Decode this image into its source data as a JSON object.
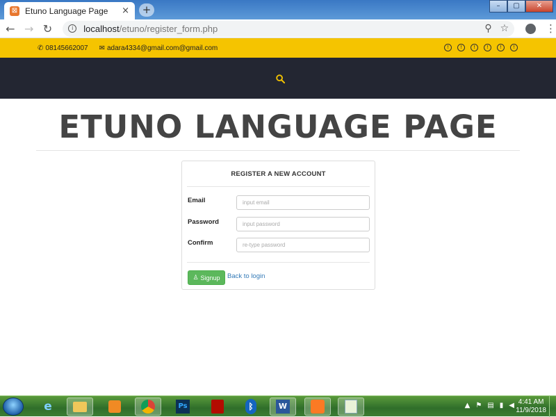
{
  "browser": {
    "tab_title": "Etuno Language Page",
    "tab_close": "×",
    "new_tab": "+",
    "window_buttons": [
      "–",
      "▢",
      "✕"
    ],
    "url_host": "localhost",
    "url_path": "/etuno/register_form.php"
  },
  "topbar": {
    "phone": "08145662007",
    "email": "adara4334@gmail.com@gmail.com",
    "social_icon_count": 6,
    "bg_color": "#f5c400"
  },
  "nav": {
    "bg_color": "#232632",
    "search_icon": "search-icon",
    "search_color": "#f5c400"
  },
  "hero": {
    "title": "ETUNO LANGUAGE PAGE"
  },
  "register": {
    "heading": "REGISTER A NEW ACCOUNT",
    "email_label": "Email",
    "email_placeholder": "input email",
    "password_label": "Password",
    "password_placeholder": "input password",
    "confirm_label": "Confirm",
    "confirm_placeholder": "re-type password",
    "signup_label": "Signup",
    "back_link": "Back to login",
    "signup_color": "#5cb85c",
    "link_color": "#337ab7"
  },
  "taskbar": {
    "apps": [
      "ie-icon",
      "explorer-icon",
      "media-player-icon",
      "chrome-icon",
      "photoshop-icon",
      "acrobat-icon",
      "bluetooth-icon",
      "word-icon",
      "xampp-icon",
      "notepad-icon"
    ],
    "ps_label": "Ps",
    "word_label": "W",
    "time": "4:41 AM",
    "date": "11/9/2018"
  }
}
